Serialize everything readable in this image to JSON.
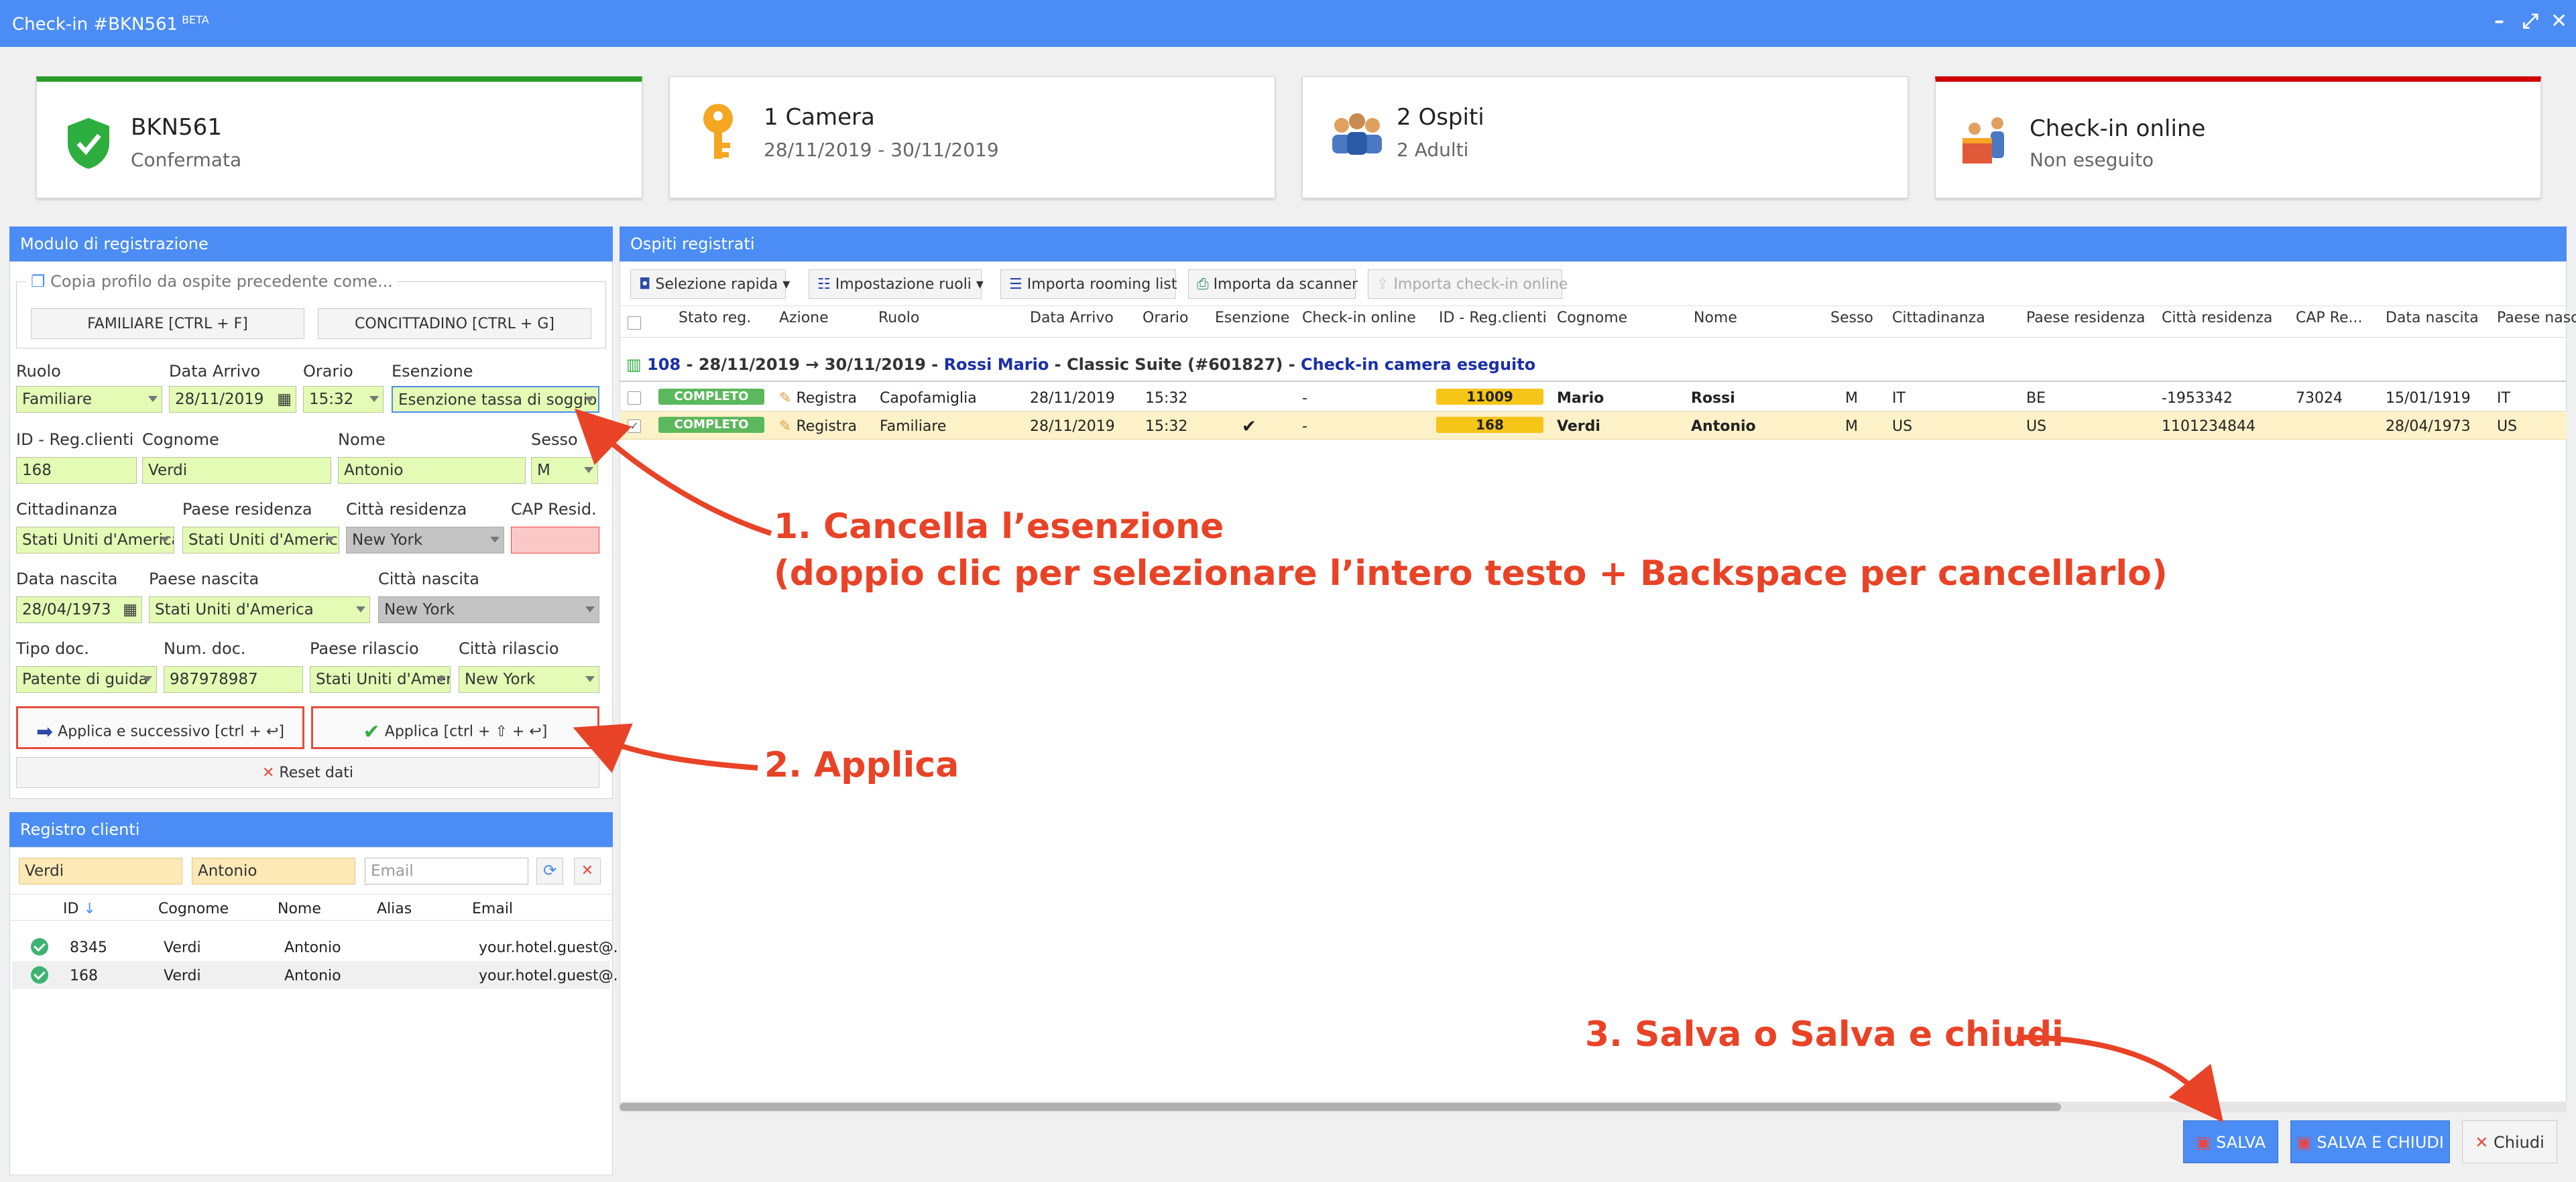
{
  "window": {
    "title": "Check-in #BKN561",
    "beta": "BETA"
  },
  "cards": [
    {
      "title": "BKN561",
      "subtitle": "Confermata",
      "accent": "#2a9d2a"
    },
    {
      "title": "1 Camera",
      "subtitle": "28/11/2019 - 30/11/2019"
    },
    {
      "title": "2 Ospiti",
      "subtitle": "2 Adulti"
    },
    {
      "title": "Check-in online",
      "subtitle": "Non eseguito",
      "accent": "#d10000"
    }
  ],
  "form": {
    "header": "Modulo di registrazione",
    "copy_legend": "Copia profilo da ospite precedente come...",
    "copy_family": "FAMILIARE [CTRL + F]",
    "copy_citizen": "CONCITTADINO [CTRL + G]",
    "labels": {
      "ruolo": "Ruolo",
      "data_arrivo": "Data Arrivo",
      "orario": "Orario",
      "esenzione": "Esenzione",
      "id": "ID - Reg.clienti",
      "cognome": "Cognome",
      "nome": "Nome",
      "sesso": "Sesso",
      "cittadinanza": "Cittadinanza",
      "paese_res": "Paese residenza",
      "citta_res": "Città residenza",
      "cap": "CAP Resid.",
      "data_nascita": "Data nascita",
      "paese_nascita": "Paese nascita",
      "citta_nascita": "Città nascita",
      "tipo_doc": "Tipo doc.",
      "num_doc": "Num. doc.",
      "paese_rilascio": "Paese rilascio",
      "citta_rilascio": "Città rilascio"
    },
    "values": {
      "ruolo": "Familiare",
      "data_arrivo": "28/11/2019",
      "orario": "15:32",
      "esenzione": "Esenzione tassa di soggiorno",
      "id": "168",
      "cognome": "Verdi",
      "nome": "Antonio",
      "sesso": "M",
      "cittadinanza": "Stati Uniti d'America",
      "paese_res": "Stati Uniti d'America",
      "citta_res": "New York",
      "cap": "",
      "data_nascita": "28/04/1973",
      "paese_nascita": "Stati Uniti d'America",
      "citta_nascita": "New York",
      "tipo_doc": "Patente di guida",
      "num_doc": "987978987",
      "paese_rilascio": "Stati Uniti d'America",
      "citta_rilascio": "New York"
    },
    "apply_next": "Applica e successivo [ctrl + ↩]",
    "apply": "Applica [ctrl + ⇧ + ↩]",
    "reset": "Reset dati"
  },
  "registry": {
    "header": "Registro clienti",
    "search_surname": "Verdi",
    "search_name": "Antonio",
    "email_placeholder": "Email",
    "columns": [
      "ID",
      "Cognome",
      "Nome",
      "Alias",
      "Email"
    ],
    "rows": [
      {
        "id": "8345",
        "cognome": "Verdi",
        "nome": "Antonio",
        "alias": "",
        "email": "your.hotel.guest@..."
      },
      {
        "id": "168",
        "cognome": "Verdi",
        "nome": "Antonio",
        "alias": "",
        "email": "your.hotel.guest@..."
      }
    ]
  },
  "guests": {
    "header": "Ospiti registrati",
    "toolbar": [
      "Selezione rapida",
      "Impostazione ruoli",
      "Importa rooming list",
      "Importa da scanner",
      "Importa check-in online"
    ],
    "columns": [
      "Stato reg.",
      "Azione",
      "Ruolo",
      "Data Arrivo",
      "Orario",
      "Esenzione",
      "Check-in online",
      "ID - Reg.clienti",
      "Cognome",
      "Nome",
      "Sesso",
      "Cittadinanza",
      "Paese residenza",
      "Città residenza",
      "CAP Re...",
      "Data nascita",
      "Paese nasc"
    ],
    "group": {
      "room": "108",
      "dates": " - 28/11/2019 → 30/11/2019 - ",
      "guest": "Rossi Mario",
      "suite": " - Classic Suite (#601827) - ",
      "status": "Check-in camera eseguito"
    },
    "rows": [
      {
        "stato": "COMPLETO",
        "azione": "Registra",
        "ruolo": "Capofamiglia",
        "data": "28/11/2019",
        "orario": "15:32",
        "esenzione": "",
        "online": "-",
        "id": "11009",
        "cognome": "Mario",
        "nome": "Rossi",
        "sesso": "M",
        "cittadinanza": "IT",
        "paese_res": "BE",
        "citta_res": "-1953342",
        "cap": "73024",
        "nascita": "15/01/1919",
        "paese_nasc": "IT"
      },
      {
        "stato": "COMPLETO",
        "azione": "Registra",
        "ruolo": "Familiare",
        "data": "28/11/2019",
        "orario": "15:32",
        "esenzione": "✔",
        "online": "-",
        "id": "168",
        "cognome": "Verdi",
        "nome": "Antonio",
        "sesso": "M",
        "cittadinanza": "US",
        "paese_res": "US",
        "citta_res": "1101234844",
        "cap": "",
        "nascita": "28/04/1973",
        "paese_nasc": "US"
      }
    ]
  },
  "footer": {
    "save": "SALVA",
    "save_close": "SALVA E CHIUDI",
    "close": "Chiudi"
  },
  "annotations": {
    "a1_line1": "1. Cancella l’esenzione",
    "a1_line2": "(doppio clic per selezionare l’intero testo + Backspace per cancellarlo)",
    "a2": "2. Applica",
    "a3": "3. Salva o Salva e chiudi"
  },
  "colors": {
    "accent": "#4b8df4",
    "annotation": "#e94327",
    "field": "#e3fbb5",
    "ok": "#5cb85c"
  }
}
